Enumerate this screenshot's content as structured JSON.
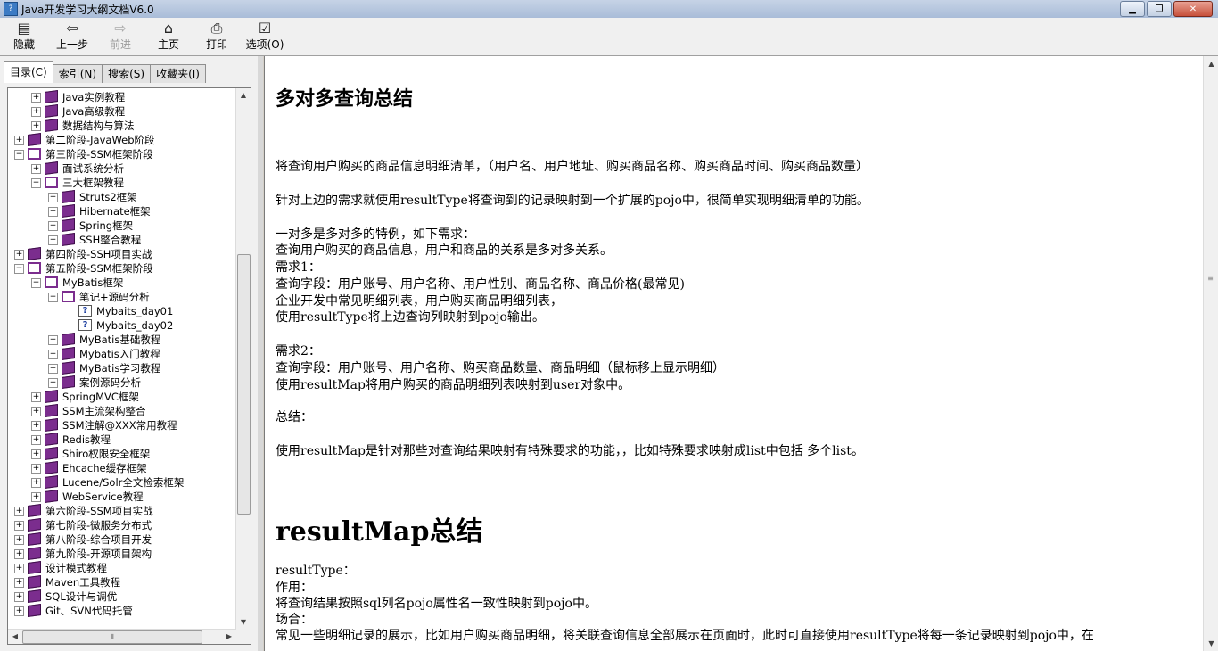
{
  "window": {
    "title": "Java开发学习大纲文档V6.0"
  },
  "toolbar": [
    {
      "label": "隐藏",
      "icon": "hide-icon",
      "glyph": "▤",
      "enabled": true
    },
    {
      "label": "上一步",
      "icon": "back-arrow-icon",
      "glyph": "⇦",
      "enabled": true
    },
    {
      "label": "前进",
      "icon": "forward-arrow-icon",
      "glyph": "⇨",
      "enabled": false
    },
    {
      "label": "主页",
      "icon": "home-icon",
      "glyph": "⌂",
      "enabled": true
    },
    {
      "label": "打印",
      "icon": "printer-icon",
      "glyph": "⎙",
      "enabled": true
    },
    {
      "label": "选项(O)",
      "icon": "options-icon",
      "glyph": "☑",
      "enabled": true
    }
  ],
  "tabs": [
    {
      "label": "目录(C)",
      "active": true
    },
    {
      "label": "索引(N)",
      "active": false
    },
    {
      "label": "搜索(S)",
      "active": false
    },
    {
      "label": "收藏夹(I)",
      "active": false
    }
  ],
  "tree": [
    {
      "label": "Java实例教程",
      "level": 1,
      "state": "closed"
    },
    {
      "label": "Java高级教程",
      "level": 1,
      "state": "closed"
    },
    {
      "label": "数据结构与算法",
      "level": 1,
      "state": "closed"
    },
    {
      "label": "第二阶段-JavaWeb阶段",
      "level": 0,
      "state": "closed"
    },
    {
      "label": "第三阶段-SSM框架阶段",
      "level": 0,
      "state": "open"
    },
    {
      "label": "面试系统分析",
      "level": 1,
      "state": "closed"
    },
    {
      "label": "三大框架教程",
      "level": 1,
      "state": "open"
    },
    {
      "label": "Struts2框架",
      "level": 2,
      "state": "closed"
    },
    {
      "label": "Hibernate框架",
      "level": 2,
      "state": "closed"
    },
    {
      "label": "Spring框架",
      "level": 2,
      "state": "closed"
    },
    {
      "label": "SSH整合教程",
      "level": 2,
      "state": "closed"
    },
    {
      "label": "第四阶段-SSH项目实战",
      "level": 0,
      "state": "closed"
    },
    {
      "label": "第五阶段-SSM框架阶段",
      "level": 0,
      "state": "open"
    },
    {
      "label": "MyBatis框架",
      "level": 1,
      "state": "open"
    },
    {
      "label": "笔记+源码分析",
      "level": 2,
      "state": "open"
    },
    {
      "label": "Mybaits_day01",
      "level": 3,
      "state": "page"
    },
    {
      "label": "Mybaits_day02",
      "level": 3,
      "state": "page"
    },
    {
      "label": "MyBatis基础教程",
      "level": 2,
      "state": "closed"
    },
    {
      "label": "Mybatis入门教程",
      "level": 2,
      "state": "closed"
    },
    {
      "label": "MyBatis学习教程",
      "level": 2,
      "state": "closed"
    },
    {
      "label": "案例源码分析",
      "level": 2,
      "state": "closed"
    },
    {
      "label": "SpringMVC框架",
      "level": 1,
      "state": "closed"
    },
    {
      "label": "SSM主流架构整合",
      "level": 1,
      "state": "closed"
    },
    {
      "label": "SSM注解@XXX常用教程",
      "level": 1,
      "state": "closed"
    },
    {
      "label": "Redis教程",
      "level": 1,
      "state": "closed"
    },
    {
      "label": "Shiro权限安全框架",
      "level": 1,
      "state": "closed"
    },
    {
      "label": "Ehcache缓存框架",
      "level": 1,
      "state": "closed"
    },
    {
      "label": "Lucene/Solr全文检索框架",
      "level": 1,
      "state": "closed"
    },
    {
      "label": "WebService教程",
      "level": 1,
      "state": "closed"
    },
    {
      "label": "第六阶段-SSM项目实战",
      "level": 0,
      "state": "closed"
    },
    {
      "label": "第七阶段-微服务分布式",
      "level": 0,
      "state": "closed"
    },
    {
      "label": "第八阶段-综合项目开发",
      "level": 0,
      "state": "closed"
    },
    {
      "label": "第九阶段-开源项目架构",
      "level": 0,
      "state": "closed"
    },
    {
      "label": "设计模式教程",
      "level": 0,
      "state": "closed"
    },
    {
      "label": "Maven工具教程",
      "level": 0,
      "state": "closed"
    },
    {
      "label": "SQL设计与调优",
      "level": 0,
      "state": "closed"
    },
    {
      "label": "Git、SVN代码托管",
      "level": 0,
      "state": "closed"
    }
  ],
  "content": {
    "heading1": "多对多查询总结",
    "lines1": [
      "将查询用户购买的商品信息明细清单，（用户名、用户地址、购买商品名称、购买商品时间、购买商品数量）",
      "针对上边的需求就使用resultType将查询到的记录映射到一个扩展的pojo中，很简单实现明细清单的功能。",
      "一对多是多对多的特例，如下需求：",
      "查询用户购买的商品信息，用户和商品的关系是多对多关系。",
      "需求1：",
      "查询字段：用户账号、用户名称、用户性别、商品名称、商品价格(最常见)",
      "企业开发中常见明细列表，用户购买商品明细列表，",
      "使用resultType将上边查询列映射到pojo输出。",
      "需求2：",
      "查询字段：用户账号、用户名称、购买商品数量、商品明细（鼠标移上显示明细）",
      "使用resultMap将用户购买的商品明细列表映射到user对象中。",
      "总结：",
      "使用resultMap是针对那些对查询结果映射有特殊要求的功能，，比如特殊要求映射成list中包括 多个list。"
    ],
    "heading2": "resultMap总结",
    "lines2": [
      "resultType：",
      "作用：",
      "将查询结果按照sql列名pojo属性名一致性映射到pojo中。",
      "场合：",
      "常见一些明细记录的展示，比如用户购买商品明细，将关联查询信息全部展示在页面时，此时可直接使用resultType将每一条记录映射到pojo中，在"
    ]
  }
}
